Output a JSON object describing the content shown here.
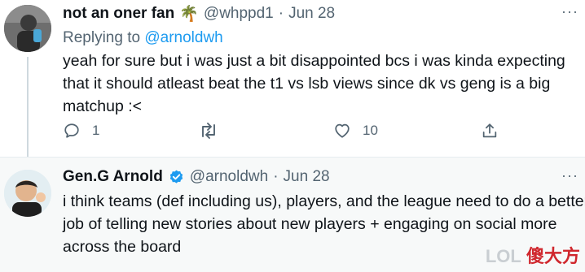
{
  "tweets": [
    {
      "name": "not an oner fan",
      "emoji": "🌴",
      "handle": "@whppd1",
      "separator": "·",
      "date": "Jun 28",
      "reply_prefix": "Replying to",
      "reply_to": "@arnoldwh",
      "lines": [
        "yeah for sure but i was just a bit disappointed bcs i was kinda expecting",
        "that it should atleast beat the t1 vs lsb views since dk vs geng is a big",
        "matchup :<"
      ],
      "replies": "1",
      "likes": "10",
      "more": "···"
    },
    {
      "name": "Gen.G Arnold",
      "handle": "@arnoldwh",
      "separator": "·",
      "date": "Jun 28",
      "lines": [
        "i think teams (def including us), players, and the league need to do a better",
        "job of telling new stories about new players + engaging on social more",
        "across the board"
      ],
      "more": "···"
    }
  ],
  "watermark": {
    "site": "LOL",
    "brand": "傻大方"
  },
  "colors": {
    "accent": "#1d9bf0",
    "muted": "#536471",
    "verified": "#1d9bf0"
  }
}
